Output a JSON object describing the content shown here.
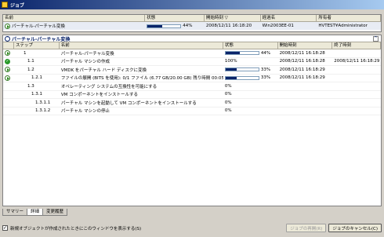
{
  "window": {
    "title": "ジョブ"
  },
  "jobs_list": {
    "columns": [
      "名前",
      "状態",
      "開始時刻 ▽",
      "経過名",
      "所有者"
    ],
    "row": {
      "name": "パーチャル-パーチャル変換",
      "progress": 0.44,
      "progress_text": "44%",
      "start": "2008/12/11 16:18:20",
      "computer": "Win2003EE-01",
      "owner": "HVTEST¥Administrator"
    }
  },
  "detail": {
    "title": "パーチャル-パーチャル変換",
    "columns": [
      "ステップ",
      "名前",
      "状態",
      "開始時刻",
      "終了時刻"
    ],
    "rows": [
      {
        "icon": "play",
        "step": "1",
        "name": "パーチャル-パーチャル変換",
        "bar": 0.44,
        "state": "44%",
        "start": "2008/12/11 16:18:28",
        "end": "",
        "indent": 0
      },
      {
        "icon": "check",
        "step": "1.1",
        "name": "パーチャル マシンの作成",
        "bar": null,
        "state": "100%",
        "start": "2008/12/11 16:18:28",
        "end": "2008/12/11 16:18:29",
        "indent": 1
      },
      {
        "icon": "play",
        "step": "1.2",
        "name": "VMDK をパーチャル ハード ディスクに変換",
        "bar": 0.33,
        "state": "33%",
        "start": "2008/12/11 16:18:29",
        "end": "",
        "indent": 1
      },
      {
        "icon": "play",
        "step": "1.2.1",
        "name": "ファイルの展開 (BITS を使用): 0/1 ファイル (6.77 GB/20.00 GB) 残り時間 00:05:49",
        "bar": 0.33,
        "state": "33%",
        "start": "2008/12/11 16:18:29",
        "end": "",
        "indent": 2
      },
      {
        "icon": "",
        "step": "1.3",
        "name": "オペレーティング システムの互換性を可能にする",
        "bar": null,
        "state": "0%",
        "start": "",
        "end": "",
        "indent": 1
      },
      {
        "icon": "",
        "step": "1.3.1",
        "name": "VM コンポーネントをインストールする",
        "bar": null,
        "state": "0%",
        "start": "",
        "end": "",
        "indent": 2
      },
      {
        "icon": "",
        "step": "1.3.1.1",
        "name": "パーチャル マシンを起動して VM コンポーネントをインストールする",
        "bar": null,
        "state": "0%",
        "start": "",
        "end": "",
        "indent": 3
      },
      {
        "icon": "",
        "step": "1.3.1.2",
        "name": "パーチャル マシンの停止",
        "bar": null,
        "state": "0%",
        "start": "",
        "end": "",
        "indent": 3
      }
    ]
  },
  "tabs": [
    "サマリー",
    "詳細",
    "変更履歴"
  ],
  "footer": {
    "checkbox_label": "新規オブジェクトが作成されたときにこのウィンドウを表示する(S)",
    "restart_label": "ジョブの再開(R)",
    "cancel_label": "ジョブのキャンセル(C)"
  }
}
